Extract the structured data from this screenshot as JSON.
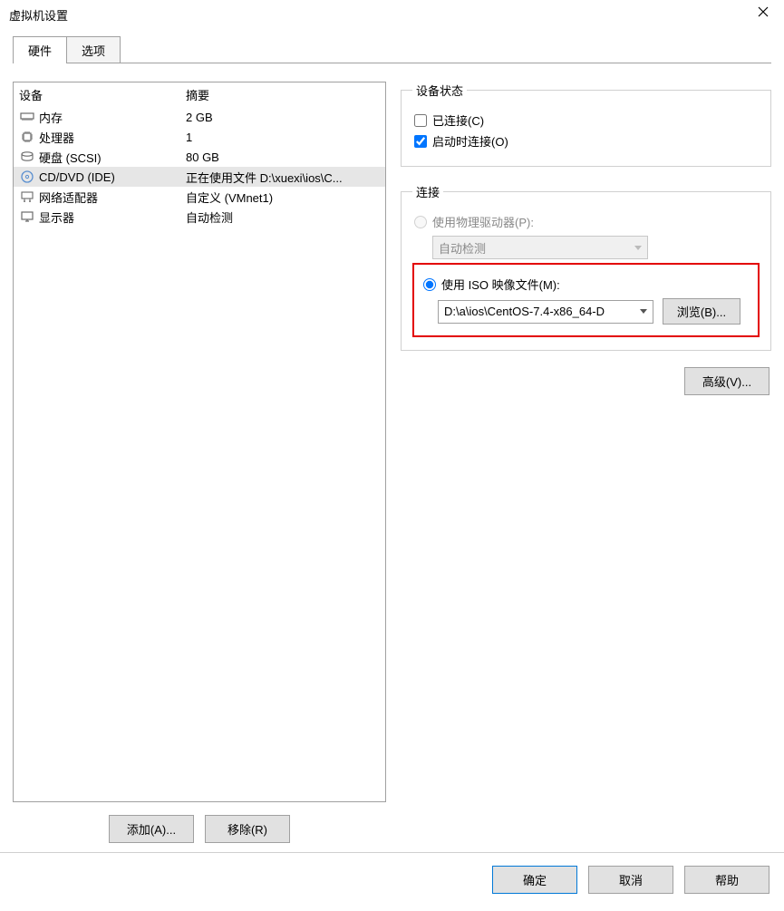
{
  "title": "虚拟机设置",
  "tabs": {
    "hardware": "硬件",
    "options": "选项"
  },
  "headers": {
    "device": "设备",
    "summary": "摘要"
  },
  "devices": {
    "memory": {
      "name": "内存",
      "summary": "2 GB"
    },
    "cpu": {
      "name": "处理器",
      "summary": "1"
    },
    "disk": {
      "name": "硬盘 (SCSI)",
      "summary": "80 GB"
    },
    "cddvd": {
      "name": "CD/DVD (IDE)",
      "summary": "正在使用文件 D:\\xuexi\\ios\\C..."
    },
    "netadapt": {
      "name": "网络适配器",
      "summary": "自定义 (VMnet1)"
    },
    "display": {
      "name": "显示器",
      "summary": "自动检测"
    }
  },
  "buttons": {
    "add": "添加(A)...",
    "remove": "移除(R)",
    "browse": "浏览(B)...",
    "advanced": "高级(V)...",
    "ok": "确定",
    "cancel": "取消",
    "help": "帮助"
  },
  "devstatus": {
    "legend": "设备状态",
    "connected": "已连接(C)",
    "connectAtPowerOn": "启动时连接(O)"
  },
  "connection": {
    "legend": "连接",
    "physical": "使用物理驱动器(P):",
    "physical_value": "自动检测",
    "iso": "使用 ISO 映像文件(M):",
    "iso_value": "D:\\a\\ios\\CentOS-7.4-x86_64-D"
  }
}
